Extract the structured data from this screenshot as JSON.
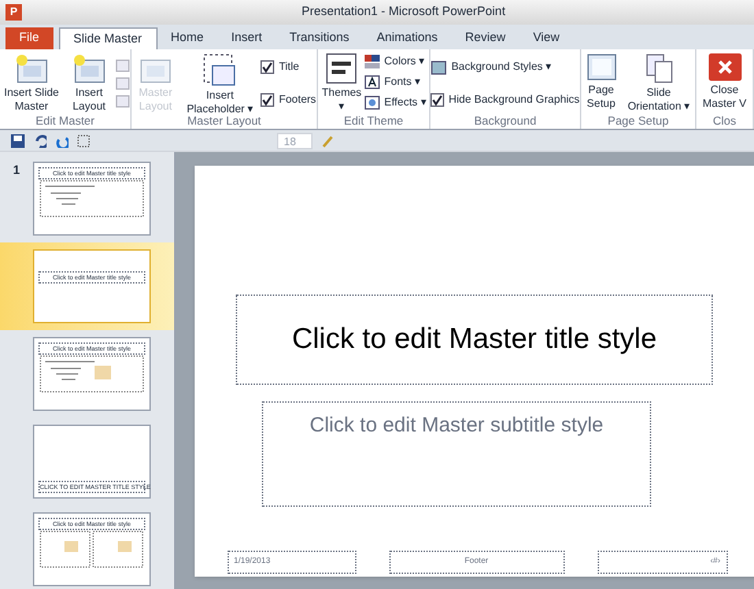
{
  "window": {
    "title": "Presentation1 - Microsoft PowerPoint",
    "app_letter": "P"
  },
  "tabs": [
    {
      "label": "File",
      "kind": "file",
      "selected": false
    },
    {
      "label": "Slide Master",
      "kind": "tab",
      "selected": true
    },
    {
      "label": "Home",
      "kind": "tab",
      "selected": false
    },
    {
      "label": "Insert",
      "kind": "tab",
      "selected": false
    },
    {
      "label": "Transitions",
      "kind": "tab",
      "selected": false
    },
    {
      "label": "Animations",
      "kind": "tab",
      "selected": false
    },
    {
      "label": "Review",
      "kind": "tab",
      "selected": false
    },
    {
      "label": "View",
      "kind": "tab",
      "selected": false
    }
  ],
  "ribbon": {
    "groups": [
      {
        "label": "Edit Master",
        "items": [
          {
            "kind": "big",
            "label": "Insert Slide Master",
            "disabled": false
          },
          {
            "kind": "big",
            "label": "Insert Layout",
            "disabled": false
          },
          {
            "kind": "icons"
          }
        ]
      },
      {
        "label": "Master Layout",
        "items": [
          {
            "kind": "big",
            "label": "Master Layout",
            "disabled": true
          },
          {
            "kind": "big",
            "label": "Insert Placeholder ▾",
            "disabled": false
          },
          {
            "kind": "checks",
            "checks": [
              {
                "label": "Title",
                "checked": true
              },
              {
                "label": "Footers",
                "checked": true
              }
            ]
          }
        ]
      },
      {
        "label": "Edit Theme",
        "items": [
          {
            "kind": "big",
            "label": "Themes ▾",
            "disabled": false
          },
          {
            "kind": "small",
            "entries": [
              {
                "label": "Colors ▾"
              },
              {
                "label": "Fonts ▾"
              },
              {
                "label": "Effects ▾"
              }
            ]
          }
        ]
      },
      {
        "label": "Background",
        "items": [
          {
            "kind": "background",
            "entries": [
              {
                "label": "Background Styles ▾"
              }
            ],
            "checks": [
              {
                "label": "Hide Background Graphics",
                "checked": true
              }
            ]
          }
        ]
      },
      {
        "label": "Page Setup",
        "items": [
          {
            "kind": "big",
            "label": "Page Setup",
            "disabled": false
          },
          {
            "kind": "big",
            "label": "Slide Orientation ▾",
            "disabled": false
          }
        ]
      },
      {
        "label": "Clos",
        "items": [
          {
            "kind": "big",
            "label": "Close Master V",
            "disabled": false
          }
        ]
      }
    ]
  },
  "quick_access": {
    "font_size": "18"
  },
  "thumbnails": [
    {
      "number": "1",
      "kind": "master",
      "title": "Click to edit Master title style",
      "selected": false
    },
    {
      "kind": "title",
      "title": "Click to edit Master title style",
      "selected": true
    },
    {
      "kind": "content",
      "title": "Click to edit Master title style",
      "selected": false
    },
    {
      "kind": "section",
      "title": "CLICK TO EDIT MASTER TITLE STYLE",
      "selected": false
    },
    {
      "kind": "two",
      "title": "Click to edit Master title style",
      "selected": false
    }
  ],
  "slide": {
    "title": "Click to edit Master title style",
    "subtitle": "Click to edit Master subtitle style",
    "date": "1/19/2013",
    "footer": "Footer",
    "number": "‹#›"
  }
}
